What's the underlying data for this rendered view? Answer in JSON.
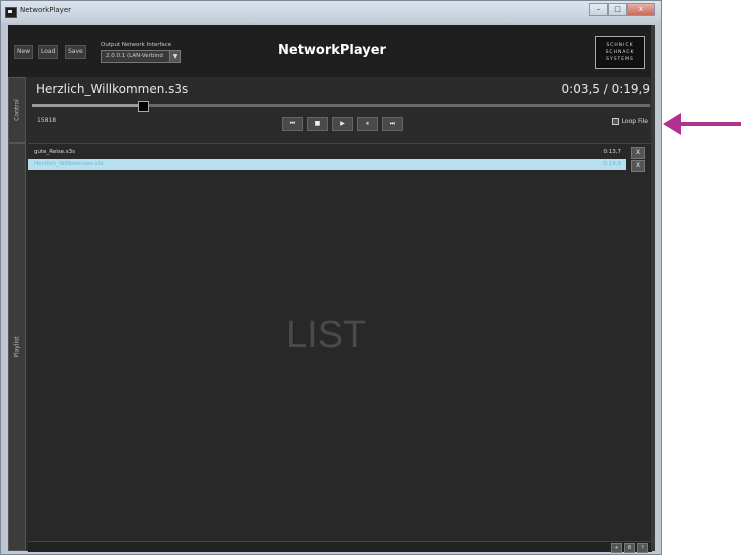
{
  "window": {
    "title": "NetworkPlayer",
    "buttons": {
      "minimize": "–",
      "maximize": "□",
      "close": "x"
    }
  },
  "header": {
    "new_label": "New",
    "load_label": "Load",
    "save_label": "Save",
    "output_label": "Output Network Interface",
    "output_value": "2.0.0.1 (LAN-Verbind",
    "dropdown_arrow": "▼",
    "app_title": "NetworkPlayer",
    "logo_lines": [
      "SCHNICK",
      "SCHNACK",
      "SYSTEMS"
    ]
  },
  "tabs": {
    "control": "Control",
    "playlist": "Playlist"
  },
  "control": {
    "file_name": "Herzlich_Willkommen.s3s",
    "time": "0:03,5 / 0:19,9",
    "progress": 0.18,
    "code": "15818",
    "transport": [
      "⏮",
      "■",
      "▶",
      "⏸",
      "⏭"
    ],
    "loop_label": "Loop File"
  },
  "playlist": {
    "items": [
      {
        "name": "gute_Reise.s3s",
        "duration": "0:13,7",
        "remove": "X"
      },
      {
        "name": "Herzlich_Willkommen.s3s",
        "duration": "0:19,9",
        "remove": "X"
      }
    ],
    "watermark": "LIST",
    "bottom_buttons": [
      "+",
      "8",
      "?"
    ]
  },
  "annotation": {
    "arrow_color": "#b0318f"
  }
}
